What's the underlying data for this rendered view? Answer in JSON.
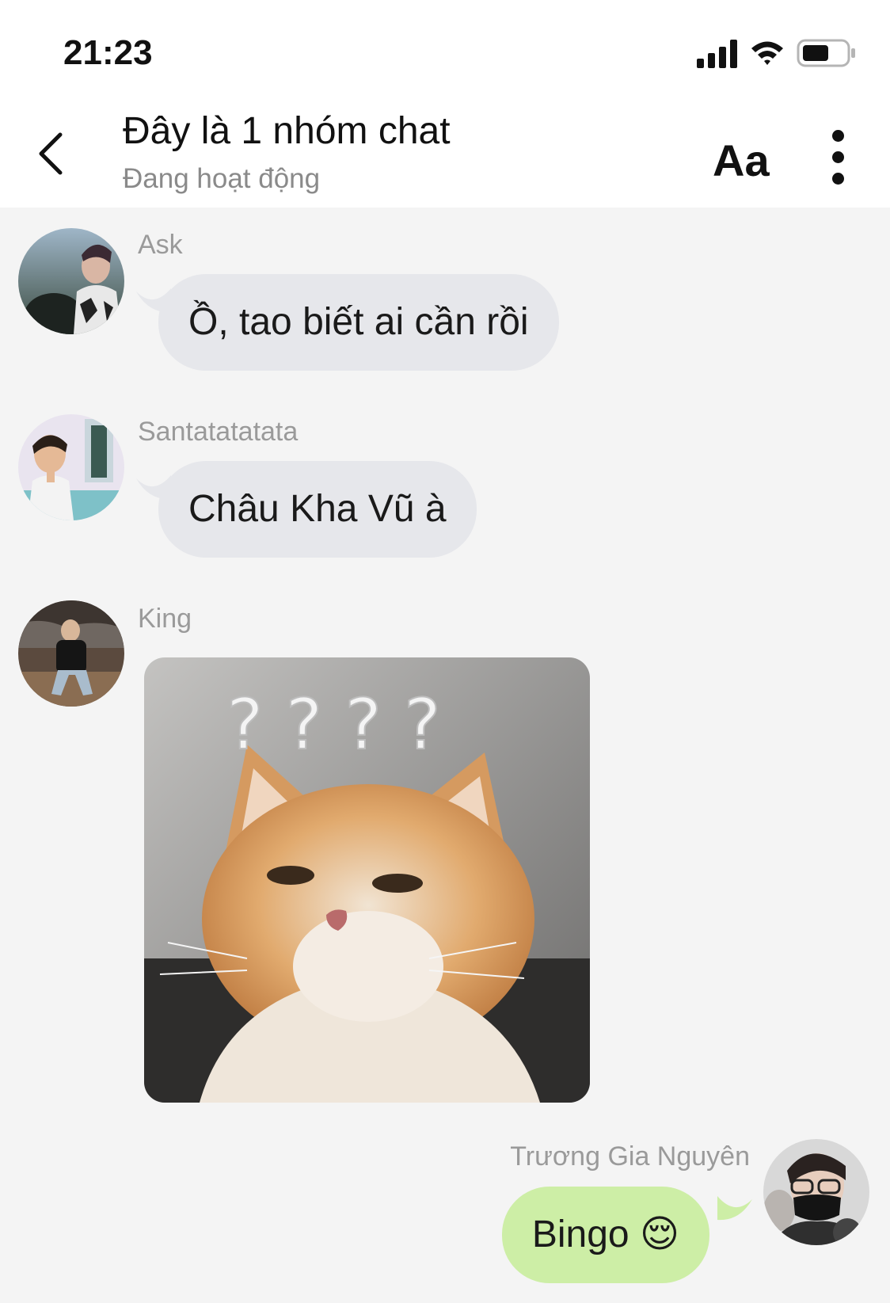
{
  "status_bar": {
    "time": "21:23"
  },
  "header": {
    "title": "Đây là 1 nhóm chat",
    "subtitle": "Đang hoạt động",
    "font_button": "Aa"
  },
  "messages": [
    {
      "sender": "Ask",
      "text": "Ồ, tao biết ai cần rồi"
    },
    {
      "sender": "Santatatatata",
      "text": "Châu Kha Vũ à"
    },
    {
      "sender": "King",
      "sticker_text": "? ? ? ?"
    },
    {
      "sender": "Trương Gia Nguyên",
      "text": "Bingo 😌"
    }
  ],
  "colors": {
    "background": "#f4f4f4",
    "incoming_bubble": "#e6e7eb",
    "outgoing_bubble": "#cdeea6",
    "sender_name": "#9a9a9a"
  }
}
